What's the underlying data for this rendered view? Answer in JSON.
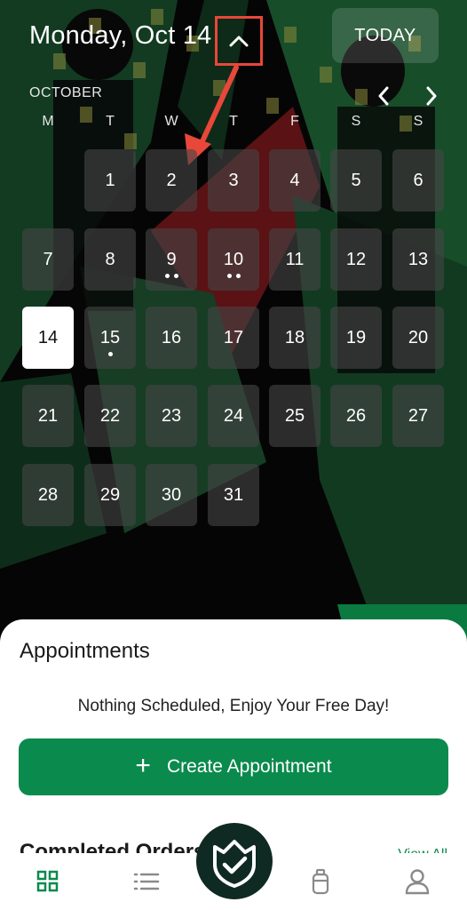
{
  "header": {
    "date_title": "Monday, Oct 14",
    "today_label": "TODAY",
    "collapse_icon": "chevron-up-icon"
  },
  "calendar": {
    "month_label": "OCTOBER",
    "weekdays": [
      "M",
      "T",
      "W",
      "T",
      "F",
      "S",
      "S"
    ],
    "first_weekday_index": 1,
    "days": [
      {
        "n": "1",
        "dots": 0
      },
      {
        "n": "2",
        "dots": 0
      },
      {
        "n": "3",
        "dots": 0
      },
      {
        "n": "4",
        "dots": 0
      },
      {
        "n": "5",
        "dots": 0
      },
      {
        "n": "6",
        "dots": 0
      },
      {
        "n": "7",
        "dots": 0
      },
      {
        "n": "8",
        "dots": 0
      },
      {
        "n": "9",
        "dots": 2
      },
      {
        "n": "10",
        "dots": 2
      },
      {
        "n": "11",
        "dots": 0
      },
      {
        "n": "12",
        "dots": 0
      },
      {
        "n": "13",
        "dots": 0
      },
      {
        "n": "14",
        "dots": 0,
        "selected": true
      },
      {
        "n": "15",
        "dots": 1
      },
      {
        "n": "16",
        "dots": 0
      },
      {
        "n": "17",
        "dots": 0
      },
      {
        "n": "18",
        "dots": 0
      },
      {
        "n": "19",
        "dots": 0
      },
      {
        "n": "20",
        "dots": 0
      },
      {
        "n": "21",
        "dots": 0
      },
      {
        "n": "22",
        "dots": 0
      },
      {
        "n": "23",
        "dots": 0
      },
      {
        "n": "24",
        "dots": 0
      },
      {
        "n": "25",
        "dots": 0
      },
      {
        "n": "26",
        "dots": 0
      },
      {
        "n": "27",
        "dots": 0
      },
      {
        "n": "28",
        "dots": 0
      },
      {
        "n": "29",
        "dots": 0
      },
      {
        "n": "30",
        "dots": 0
      },
      {
        "n": "31",
        "dots": 0
      }
    ]
  },
  "appointments": {
    "title": "Appointments",
    "empty_message": "Nothing Scheduled, Enjoy Your Free Day!",
    "create_label": "Create Appointment"
  },
  "orders": {
    "title": "Completed Orders",
    "view_all": "View All"
  },
  "bottom_nav": {
    "items": [
      "grid-icon",
      "list-icon",
      "shield-check-icon",
      "bottle-icon",
      "person-icon"
    ]
  },
  "colors": {
    "accent": "#0b8a4d",
    "annotation": "#e8473a",
    "fab": "#0f2a22"
  }
}
